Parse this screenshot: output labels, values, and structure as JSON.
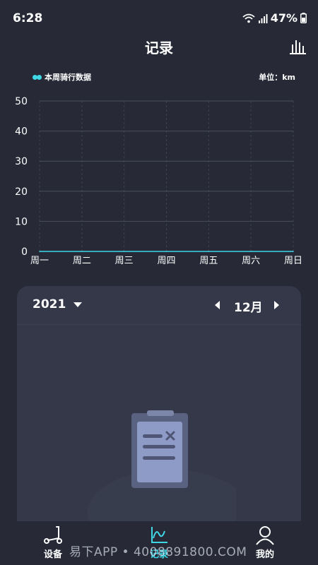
{
  "status_bar": {
    "time": "6:28",
    "battery": "47%"
  },
  "header": {
    "title": "记录"
  },
  "chart_data": {
    "type": "line",
    "legend": "本周骑行数据",
    "unit_label": "单位：km",
    "categories": [
      "周一",
      "周二",
      "周三",
      "周四",
      "周五",
      "周六",
      "周日"
    ],
    "values": [
      0,
      0,
      0,
      0,
      0,
      0,
      0
    ],
    "yticks": [
      0,
      10,
      20,
      30,
      40,
      50
    ],
    "ylim": [
      0,
      50
    ],
    "grid": true,
    "line_color": "#3fd7e6"
  },
  "calendar": {
    "year": "2021",
    "month": "12月"
  },
  "tabs": [
    {
      "label": "设备",
      "icon": "scooter-icon",
      "active": false
    },
    {
      "label": "记录",
      "icon": "chart-line-icon",
      "active": true
    },
    {
      "label": "我的",
      "icon": "user-icon",
      "active": false
    }
  ],
  "watermark": "易下APP • 4008891800.COM",
  "colors": {
    "accent": "#3fd7e6",
    "background": "#272a36",
    "card": "#343848"
  }
}
